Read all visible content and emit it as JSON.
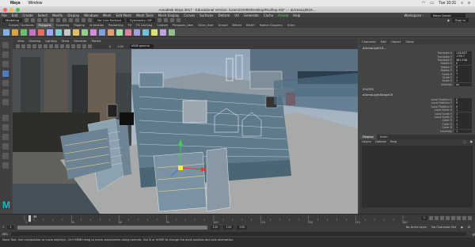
{
  "mac": {
    "app_name": "Maya",
    "menus": [
      "Window"
    ],
    "clock": "Tue 10:31"
  },
  "window": {
    "title": "Autodesk Maya 2017 - Educational Version: /Users/22095/Desktop/Rooftop.mb*  ---  aiAreaLight19...."
  },
  "main_menu": {
    "items": [
      "File",
      "Edit",
      "Create",
      "Select",
      "Modify",
      "Display",
      "Windows",
      "Mesh",
      "Edit Mesh",
      "Mesh Tools",
      "Mesh Display",
      "Curves",
      "Surfaces",
      "Deform",
      "UV",
      "Generate",
      "Cache",
      "Arnold",
      "Help"
    ],
    "selected_index": 17,
    "workspace_label": "Workspace :",
    "workspace_value": "Maya Classic"
  },
  "status_line": {
    "mode": "Modeling",
    "live_surface": "No Live Surface",
    "symmetry": "Symmetry: Off",
    "sign_in": "Sign in"
  },
  "shelf": {
    "tabs": [
      "Curves / Surfaces",
      "Polygons",
      "Sculpting",
      "Rigging",
      "Animation",
      "Rendering",
      "FX",
      "FX Caching",
      "Custom",
      "Polygons_User",
      "XGen_User",
      "Arnold",
      "Bifrost",
      "MASH",
      "Motion Graphics",
      "XGen"
    ],
    "active_tab": 1,
    "icon_colors": [
      "#7fb2e5",
      "#d9a441",
      "#6cc16c",
      "#c76fc1",
      "#e07060",
      "#9fa8ff",
      "#78d0d0",
      "#c9c9c9",
      "#e0c060",
      "#8fd08f",
      "#d08fd0",
      "#7fa0e0",
      "#e0a070",
      "#a0e0a0",
      "#e07fa0",
      "#a0a0e0",
      "#70c0e0",
      "#e0e070",
      "#c0a0e0",
      "#90c090"
    ]
  },
  "viewport": {
    "menu": [
      "View",
      "Shading",
      "Lighting",
      "Show",
      "Renderer",
      "Panels"
    ],
    "camera": "persp (perspShape)",
    "stat_left": "0",
    "stat_mid": "1.00",
    "stat_right": "sRGB gamma"
  },
  "channel_box": {
    "menu": [
      "Channels",
      "Edit",
      "Object",
      "Show"
    ],
    "node_name": "aiAreaLight19...",
    "attributes": [
      {
        "name": "Translate X",
        "value": "118.657"
      },
      {
        "name": "Translate Y",
        "value": "-276.7"
      },
      {
        "name": "Translate Z",
        "value": "387.538"
      },
      {
        "name": "Rotate X",
        "value": "0"
      },
      {
        "name": "Rotate Y",
        "value": "0"
      },
      {
        "name": "Rotate Z",
        "value": "0"
      },
      {
        "name": "Scale X",
        "value": "1"
      },
      {
        "name": "Scale Y",
        "value": "1"
      },
      {
        "name": "Scale Z",
        "value": "1"
      },
      {
        "name": "Visibility",
        "value": "on"
      }
    ],
    "shapes_label": "SHAPES",
    "shape_name": "aiAreaLightShape19",
    "shape_attributes": [
      {
        "name": "Local Position X",
        "value": "0"
      },
      {
        "name": "Local Position Y",
        "value": "0"
      },
      {
        "name": "Local Position Z",
        "value": "0"
      },
      {
        "name": "Local Scale X",
        "value": "1"
      },
      {
        "name": "Local Scale Y",
        "value": "1"
      },
      {
        "name": "Local Scale Z",
        "value": "1"
      },
      {
        "name": "Color R",
        "value": "1"
      },
      {
        "name": "Color G",
        "value": "1"
      },
      {
        "name": "Color B",
        "value": "1"
      },
      {
        "name": "Intensity",
        "value": "1"
      }
    ]
  },
  "layer_editor": {
    "tabs": [
      "Display",
      "Anim"
    ],
    "menu": [
      "Layers",
      "Options",
      "Help"
    ]
  },
  "timeline": {
    "ticks": [
      "1",
      "25",
      "50",
      "75",
      "100",
      "125",
      "150",
      "175",
      "200"
    ],
    "current_frame": "39",
    "current_frame_field": "1"
  },
  "range": {
    "start": "1",
    "start_field": "1",
    "end_field": "120",
    "end": "120",
    "max": "200",
    "anim_layer": "No Anim Layer",
    "character_set": "No Character Set"
  },
  "mel_label": "MEL",
  "help_line": "Move Tool: Use manipulator to move object(s). Ctrl+MMB+drag to move components along normals. Use D or HOME to change the pivot position and axis orientation."
}
